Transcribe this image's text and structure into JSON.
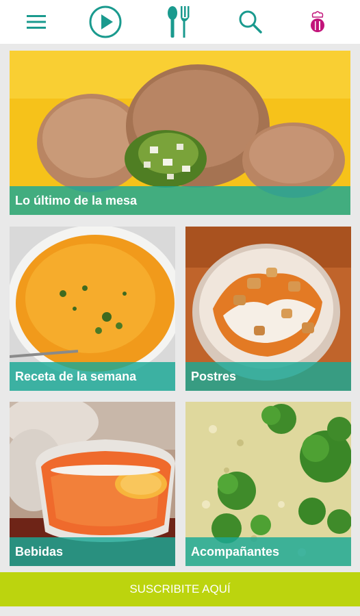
{
  "topbar": {
    "icons": [
      "menu-icon",
      "play-icon",
      "cutlery-icon",
      "search-icon",
      "chef-profile-icon"
    ],
    "accent_color": "#1a9a8e",
    "profile_color": "#c2147a"
  },
  "cards": {
    "hero": {
      "label": "Lo último de la mesa"
    },
    "weekly": {
      "label": "Receta de la semana"
    },
    "desserts": {
      "label": "Postres"
    },
    "drinks": {
      "label": "Bebidas"
    },
    "sides": {
      "label": "Acompañantes"
    }
  },
  "caption_color": "#1aa896",
  "subscribe": {
    "label": "SUSCRIBITE AQUÍ",
    "color": "#bcd40e"
  }
}
